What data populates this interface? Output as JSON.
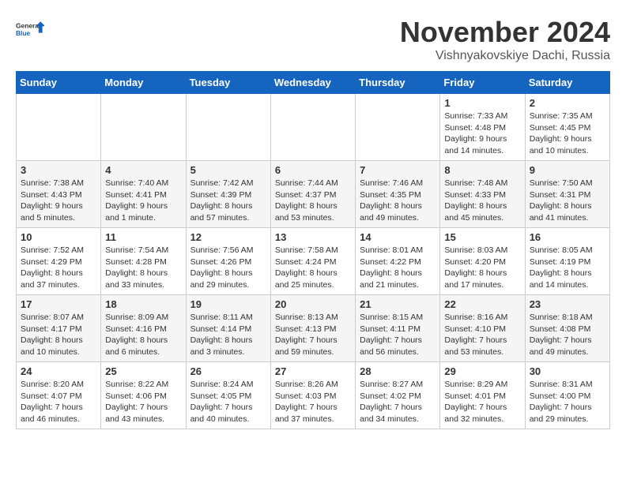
{
  "logo": {
    "line1": "General",
    "line2": "Blue"
  },
  "title": "November 2024",
  "location": "Vishnyakovskiye Dachi, Russia",
  "weekdays": [
    "Sunday",
    "Monday",
    "Tuesday",
    "Wednesday",
    "Thursday",
    "Friday",
    "Saturday"
  ],
  "weeks": [
    [
      {
        "day": "",
        "info": ""
      },
      {
        "day": "",
        "info": ""
      },
      {
        "day": "",
        "info": ""
      },
      {
        "day": "",
        "info": ""
      },
      {
        "day": "",
        "info": ""
      },
      {
        "day": "1",
        "info": "Sunrise: 7:33 AM\nSunset: 4:48 PM\nDaylight: 9 hours and 14 minutes."
      },
      {
        "day": "2",
        "info": "Sunrise: 7:35 AM\nSunset: 4:45 PM\nDaylight: 9 hours and 10 minutes."
      }
    ],
    [
      {
        "day": "3",
        "info": "Sunrise: 7:38 AM\nSunset: 4:43 PM\nDaylight: 9 hours and 5 minutes."
      },
      {
        "day": "4",
        "info": "Sunrise: 7:40 AM\nSunset: 4:41 PM\nDaylight: 9 hours and 1 minute."
      },
      {
        "day": "5",
        "info": "Sunrise: 7:42 AM\nSunset: 4:39 PM\nDaylight: 8 hours and 57 minutes."
      },
      {
        "day": "6",
        "info": "Sunrise: 7:44 AM\nSunset: 4:37 PM\nDaylight: 8 hours and 53 minutes."
      },
      {
        "day": "7",
        "info": "Sunrise: 7:46 AM\nSunset: 4:35 PM\nDaylight: 8 hours and 49 minutes."
      },
      {
        "day": "8",
        "info": "Sunrise: 7:48 AM\nSunset: 4:33 PM\nDaylight: 8 hours and 45 minutes."
      },
      {
        "day": "9",
        "info": "Sunrise: 7:50 AM\nSunset: 4:31 PM\nDaylight: 8 hours and 41 minutes."
      }
    ],
    [
      {
        "day": "10",
        "info": "Sunrise: 7:52 AM\nSunset: 4:29 PM\nDaylight: 8 hours and 37 minutes."
      },
      {
        "day": "11",
        "info": "Sunrise: 7:54 AM\nSunset: 4:28 PM\nDaylight: 8 hours and 33 minutes."
      },
      {
        "day": "12",
        "info": "Sunrise: 7:56 AM\nSunset: 4:26 PM\nDaylight: 8 hours and 29 minutes."
      },
      {
        "day": "13",
        "info": "Sunrise: 7:58 AM\nSunset: 4:24 PM\nDaylight: 8 hours and 25 minutes."
      },
      {
        "day": "14",
        "info": "Sunrise: 8:01 AM\nSunset: 4:22 PM\nDaylight: 8 hours and 21 minutes."
      },
      {
        "day": "15",
        "info": "Sunrise: 8:03 AM\nSunset: 4:20 PM\nDaylight: 8 hours and 17 minutes."
      },
      {
        "day": "16",
        "info": "Sunrise: 8:05 AM\nSunset: 4:19 PM\nDaylight: 8 hours and 14 minutes."
      }
    ],
    [
      {
        "day": "17",
        "info": "Sunrise: 8:07 AM\nSunset: 4:17 PM\nDaylight: 8 hours and 10 minutes."
      },
      {
        "day": "18",
        "info": "Sunrise: 8:09 AM\nSunset: 4:16 PM\nDaylight: 8 hours and 6 minutes."
      },
      {
        "day": "19",
        "info": "Sunrise: 8:11 AM\nSunset: 4:14 PM\nDaylight: 8 hours and 3 minutes."
      },
      {
        "day": "20",
        "info": "Sunrise: 8:13 AM\nSunset: 4:13 PM\nDaylight: 7 hours and 59 minutes."
      },
      {
        "day": "21",
        "info": "Sunrise: 8:15 AM\nSunset: 4:11 PM\nDaylight: 7 hours and 56 minutes."
      },
      {
        "day": "22",
        "info": "Sunrise: 8:16 AM\nSunset: 4:10 PM\nDaylight: 7 hours and 53 minutes."
      },
      {
        "day": "23",
        "info": "Sunrise: 8:18 AM\nSunset: 4:08 PM\nDaylight: 7 hours and 49 minutes."
      }
    ],
    [
      {
        "day": "24",
        "info": "Sunrise: 8:20 AM\nSunset: 4:07 PM\nDaylight: 7 hours and 46 minutes."
      },
      {
        "day": "25",
        "info": "Sunrise: 8:22 AM\nSunset: 4:06 PM\nDaylight: 7 hours and 43 minutes."
      },
      {
        "day": "26",
        "info": "Sunrise: 8:24 AM\nSunset: 4:05 PM\nDaylight: 7 hours and 40 minutes."
      },
      {
        "day": "27",
        "info": "Sunrise: 8:26 AM\nSunset: 4:03 PM\nDaylight: 7 hours and 37 minutes."
      },
      {
        "day": "28",
        "info": "Sunrise: 8:27 AM\nSunset: 4:02 PM\nDaylight: 7 hours and 34 minutes."
      },
      {
        "day": "29",
        "info": "Sunrise: 8:29 AM\nSunset: 4:01 PM\nDaylight: 7 hours and 32 minutes."
      },
      {
        "day": "30",
        "info": "Sunrise: 8:31 AM\nSunset: 4:00 PM\nDaylight: 7 hours and 29 minutes."
      }
    ]
  ]
}
